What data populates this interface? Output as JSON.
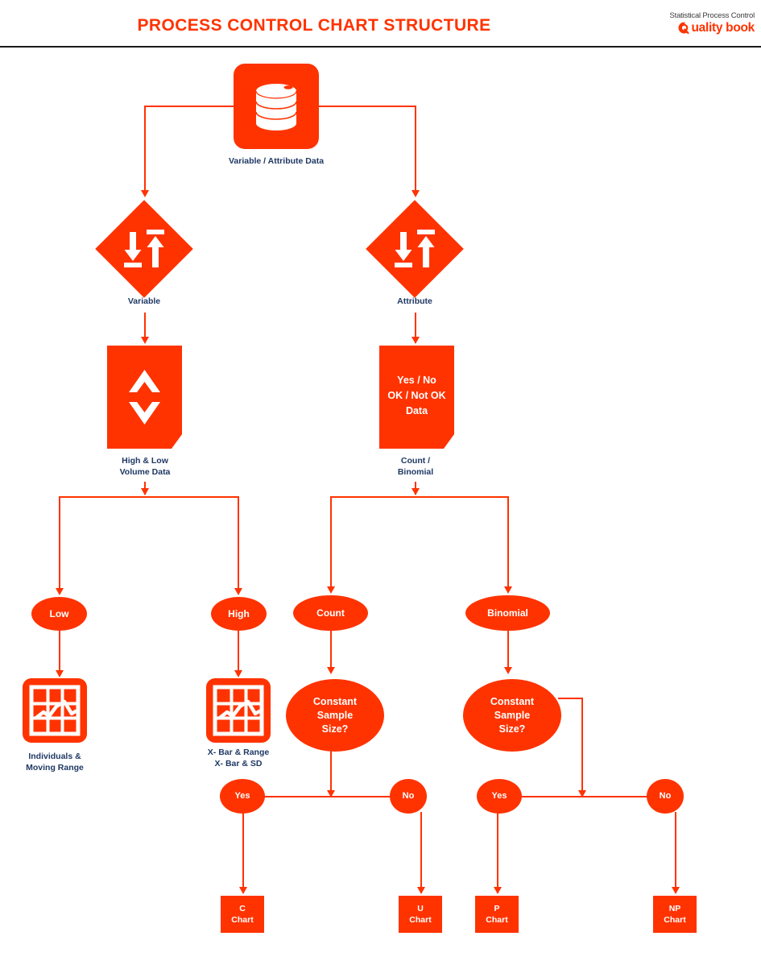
{
  "header": {
    "title": "PROCESS CONTROL CHART STRUCTURE",
    "logo_tagline": "Statistical Process Control",
    "logo_brand": "uality book",
    "title_color": "#FF3300",
    "rule_color": "#1A1A1A"
  },
  "theme": {
    "accent": "#FF3300",
    "label_color": "#1F3864",
    "background": "#FFFFFF",
    "node_text_color": "#FFFFFF"
  },
  "chart_data": {
    "type": "diagram",
    "title": "PROCESS CONTROL CHART STRUCTURE",
    "orientation": "top-down",
    "nodes": [
      {
        "id": "data_source",
        "label": "Variable / Attribute Data",
        "shape": "rounded-tile",
        "icon": "database-icon",
        "label_position": "below"
      },
      {
        "id": "variable",
        "label": "Variable",
        "shape": "diamond",
        "icon": "sort-arrows-icon",
        "label_position": "below"
      },
      {
        "id": "attribute",
        "label": "Attribute",
        "shape": "diamond",
        "icon": "sort-arrows-icon",
        "label_position": "below"
      },
      {
        "id": "volume_data",
        "label": "High & Low\nVolume Data",
        "shape": "document",
        "icon": "up-down-chevron-icon",
        "label_position": "below"
      },
      {
        "id": "yesno_data",
        "label": "Count /\nBinomial",
        "shape": "document",
        "inner_text": "Yes / No\nOK / Not OK\nData",
        "label_position": "below"
      },
      {
        "id": "low",
        "label": "Low",
        "shape": "ellipse"
      },
      {
        "id": "high",
        "label": "High",
        "shape": "ellipse"
      },
      {
        "id": "count",
        "label": "Count",
        "shape": "ellipse"
      },
      {
        "id": "binomial",
        "label": "Binomial",
        "shape": "ellipse"
      },
      {
        "id": "imr",
        "label": "Individuals  &\nMoving  Range",
        "shape": "rounded-tile",
        "icon": "control-chart-icon",
        "label_position": "below"
      },
      {
        "id": "xbar",
        "label": "X- Bar  &  Range\nX- Bar  &  SD",
        "shape": "rounded-tile",
        "icon": "control-chart-icon",
        "label_position": "below"
      },
      {
        "id": "count_css",
        "label": "Constant\nSample\nSize?",
        "shape": "ellipse"
      },
      {
        "id": "binomial_css",
        "label": "Constant\nSample\nSize?",
        "shape": "ellipse"
      },
      {
        "id": "count_yes",
        "label": "Yes",
        "shape": "ellipse"
      },
      {
        "id": "count_no",
        "label": "No",
        "shape": "ellipse"
      },
      {
        "id": "binomial_yes",
        "label": "Yes",
        "shape": "ellipse"
      },
      {
        "id": "binomial_no",
        "label": "No",
        "shape": "ellipse"
      },
      {
        "id": "c_chart",
        "label": "C\nChart",
        "shape": "rectangle"
      },
      {
        "id": "u_chart",
        "label": "U\nChart",
        "shape": "rectangle"
      },
      {
        "id": "p_chart",
        "label": "P\nChart",
        "shape": "rectangle"
      },
      {
        "id": "np_chart",
        "label": "NP\nChart",
        "shape": "rectangle"
      }
    ],
    "edges": [
      {
        "from": "data_source",
        "to": "variable"
      },
      {
        "from": "data_source",
        "to": "attribute"
      },
      {
        "from": "variable",
        "to": "volume_data"
      },
      {
        "from": "attribute",
        "to": "yesno_data"
      },
      {
        "from": "volume_data",
        "to": "low"
      },
      {
        "from": "volume_data",
        "to": "high"
      },
      {
        "from": "yesno_data",
        "to": "count"
      },
      {
        "from": "yesno_data",
        "to": "binomial"
      },
      {
        "from": "low",
        "to": "imr"
      },
      {
        "from": "high",
        "to": "xbar"
      },
      {
        "from": "count",
        "to": "count_css"
      },
      {
        "from": "binomial",
        "to": "binomial_css"
      },
      {
        "from": "count_css",
        "to": "count_yes"
      },
      {
        "from": "count_css",
        "to": "count_no"
      },
      {
        "from": "binomial_css",
        "to": "binomial_yes"
      },
      {
        "from": "binomial_css",
        "to": "binomial_no"
      },
      {
        "from": "count_yes",
        "to": "c_chart"
      },
      {
        "from": "count_no",
        "to": "u_chart"
      },
      {
        "from": "binomial_yes",
        "to": "p_chart"
      },
      {
        "from": "binomial_no",
        "to": "np_chart"
      }
    ]
  },
  "labels": {
    "data_source": "Variable / Attribute Data",
    "variable": "Variable",
    "attribute": "Attribute",
    "volume_data": "High & Low\nVolume Data",
    "yesno_data_inner": "Yes / No\nOK / Not OK\nData",
    "yesno_data": "Count /\nBinomial",
    "low": "Low",
    "high": "High",
    "count": "Count",
    "binomial": "Binomial",
    "imr": "Individuals  &\nMoving  Range",
    "xbar": "X- Bar  &  Range\nX- Bar  &  SD",
    "count_css": "Constant\nSample\nSize?",
    "binomial_css": "Constant\nSample\nSize?",
    "count_yes": "Yes",
    "count_no": "No",
    "binomial_yes": "Yes",
    "binomial_no": "No",
    "c_chart": "C\nChart",
    "u_chart": "U\nChart",
    "p_chart": "P\nChart",
    "np_chart": "NP\nChart"
  }
}
